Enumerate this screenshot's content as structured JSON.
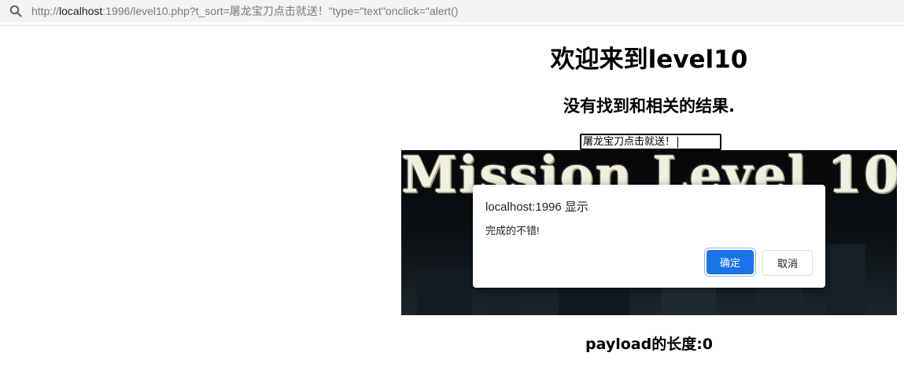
{
  "address_bar": {
    "icon": "search-icon",
    "url_prefix": "http://",
    "url_host": "localhost",
    "url_rest": ":1996/level10.php?t_sort=屠龙宝刀点击就送！\"type=\"text\"onclick=\"alert()"
  },
  "page": {
    "title": "欢迎来到level10",
    "subtitle": "没有找到和相关的结果.",
    "input_value": "屠龙宝刀点击就送！",
    "banner_text": "Mission Level 10",
    "payload_length": "payload的长度:0"
  },
  "dialog": {
    "title": "localhost:1996 显示",
    "message": "完成的不错!",
    "ok_label": "确定",
    "cancel_label": "取消",
    "ok_color": "#1a73e8"
  }
}
